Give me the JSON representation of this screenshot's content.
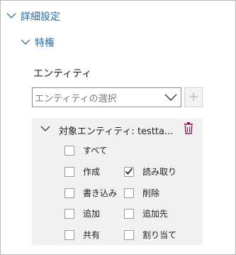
{
  "sections": {
    "advanced": {
      "label": "詳細設定"
    },
    "privileges": {
      "label": "特権"
    }
  },
  "entity": {
    "title": "エンティティ",
    "select_placeholder": "エンティティの選択",
    "add_icon": "plus-icon"
  },
  "target": {
    "title": "対象エンティティ: testta...",
    "delete_icon": "trash-icon",
    "accent_color": "#8b1a57",
    "permissions": [
      {
        "label": "すべて",
        "checked": false
      },
      {
        "label": "作成",
        "checked": false
      },
      {
        "label": "読み取り",
        "checked": true
      },
      {
        "label": "書き込み",
        "checked": false
      },
      {
        "label": "削除",
        "checked": false
      },
      {
        "label": "追加",
        "checked": false
      },
      {
        "label": "追加先",
        "checked": false
      },
      {
        "label": "共有",
        "checked": false
      },
      {
        "label": "割り当て",
        "checked": false
      }
    ]
  },
  "colors": {
    "link": "#2f6aa3",
    "panel_bg": "#f1f1f1"
  }
}
